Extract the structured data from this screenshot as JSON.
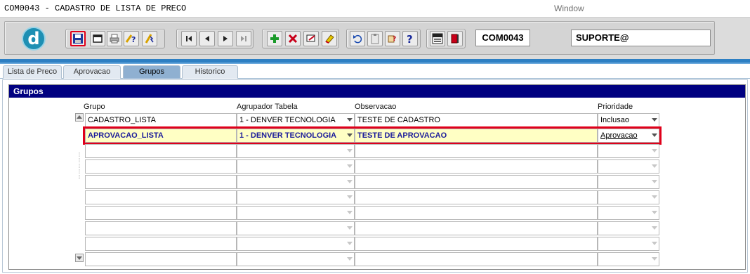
{
  "window": {
    "title": "COM0043 - CADASTRO DE LISTA DE PRECO",
    "menu_window": "Window"
  },
  "toolbar": {
    "logo_letter": "d",
    "form_code": "COM0043",
    "user": "SUPORTE@"
  },
  "tabs": [
    {
      "label": "Lista de Preco",
      "active": false
    },
    {
      "label": "Aprovacao",
      "active": false
    },
    {
      "label": "Grupos",
      "active": true
    },
    {
      "label": "Historico",
      "active": false
    }
  ],
  "section": {
    "title": "Grupos",
    "columns": {
      "grupo": "Grupo",
      "agrupador": "Agrupador Tabela",
      "observacao": "Observacao",
      "prioridade": "Prioridade"
    }
  },
  "rows": [
    {
      "grupo": "CADASTRO_LISTA",
      "agrupador": "1 - DENVER TECNOLOGIA",
      "observacao": "TESTE DE CADASTRO",
      "prioridade": "Inclusao"
    },
    {
      "grupo": "APROVACAO_LISTA",
      "agrupador": "1 - DENVER TECNOLOGIA",
      "observacao": "TESTE DE APROVACAO",
      "prioridade": "Aprovacao"
    }
  ],
  "colors": {
    "accent_blue": "#2d7fc3",
    "section_header": "#000080",
    "highlight_border": "#e0001a",
    "row_highlight_bg": "#ffffc4"
  }
}
